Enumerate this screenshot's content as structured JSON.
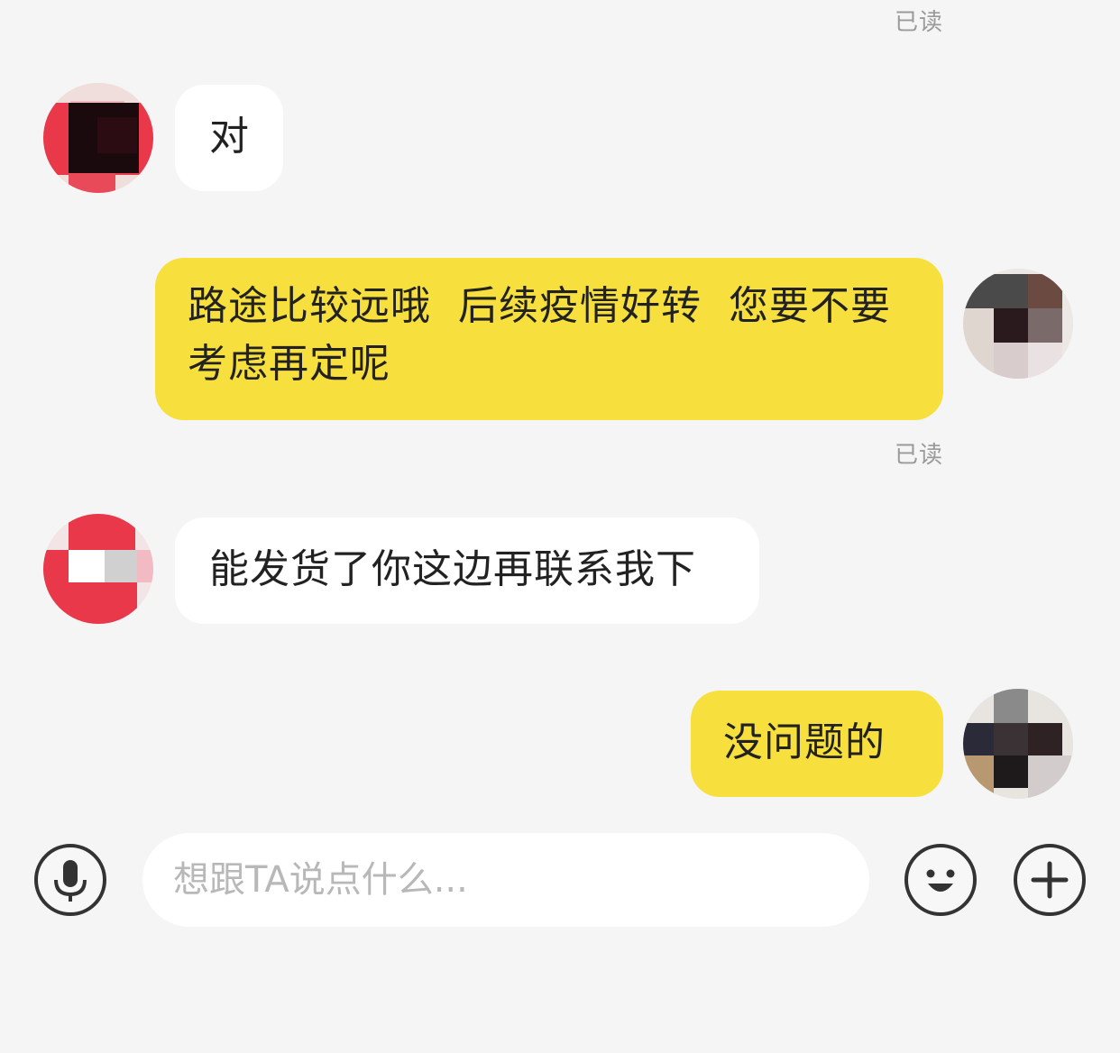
{
  "chat": {
    "read_receipt_top": "已读",
    "read_receipt_middle": "已读",
    "messages": [
      {
        "sender": "other",
        "text": "对"
      },
      {
        "sender": "me",
        "line1": "路途比较远哦  后续疫情好转  您要不要",
        "line2": "考虑再定呢"
      },
      {
        "sender": "other",
        "text": "能发货了你这边再联系我下"
      },
      {
        "sender": "me",
        "text": "没问题的"
      }
    ]
  },
  "composer": {
    "placeholder": "想跟TA说点什么...",
    "voice_icon": "microphone-icon",
    "emoji_icon": "smiley-icon",
    "plus_icon": "plus-icon"
  },
  "colors": {
    "background": "#f5f5f5",
    "outgoing_bubble": "#f7df3d",
    "incoming_bubble": "#ffffff",
    "text": "#222222",
    "muted": "#9a9a9a"
  }
}
